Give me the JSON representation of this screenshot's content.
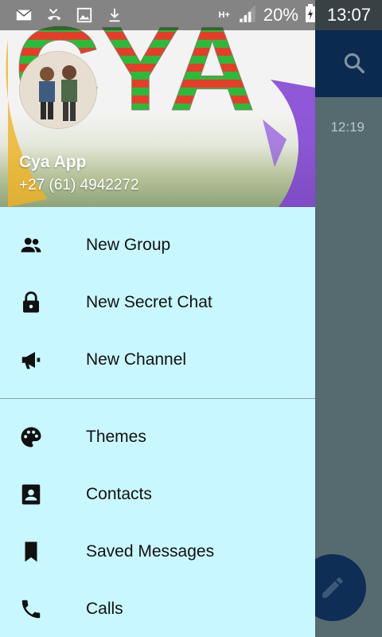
{
  "status_bar": {
    "network": "H+",
    "battery": "20%",
    "time": "13:07"
  },
  "background": {
    "chat_time": "12:19"
  },
  "drawer": {
    "header": {
      "logo_text": "CYA",
      "name": "Cya App",
      "phone": "+27 (61) 4942272"
    },
    "items": [
      {
        "label": "New Group",
        "icon": "group-icon"
      },
      {
        "label": "New Secret Chat",
        "icon": "lock-icon"
      },
      {
        "label": "New Channel",
        "icon": "megaphone-icon"
      },
      {
        "label": "Themes",
        "icon": "palette-icon"
      },
      {
        "label": "Contacts",
        "icon": "contact-card-icon"
      },
      {
        "label": "Saved Messages",
        "icon": "bookmark-icon"
      },
      {
        "label": "Calls",
        "icon": "phone-icon"
      }
    ]
  },
  "colors": {
    "drawer_bg": "#c9f7ff",
    "toolbar": "#0b2a4f",
    "fab": "#0f2e55"
  }
}
